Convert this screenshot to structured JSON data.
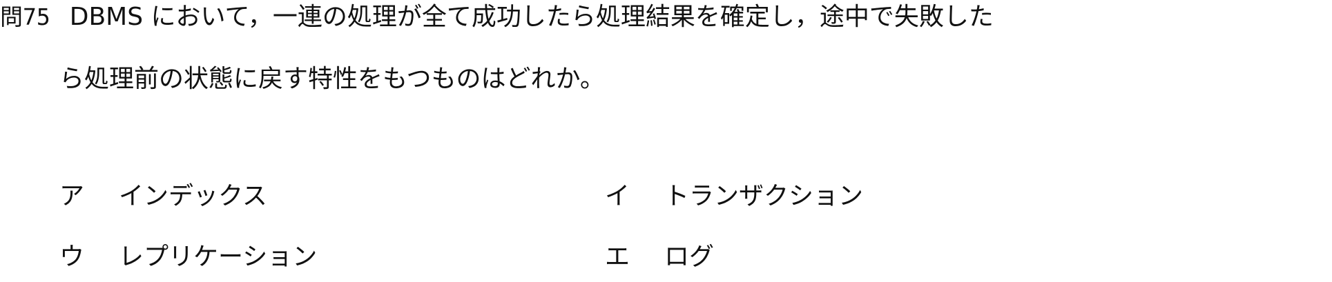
{
  "question": {
    "number": "問75",
    "line1": "DBMS において，一連の処理が全て成功したら処理結果を確定し，途中で失敗した",
    "line2": "ら処理前の状態に戻す特性をもつものはどれか。"
  },
  "choices": [
    {
      "key": "ア",
      "text": "インデックス"
    },
    {
      "key": "イ",
      "text": "トランザクション"
    },
    {
      "key": "ウ",
      "text": "レプリケーション"
    },
    {
      "key": "エ",
      "text": "ログ"
    }
  ]
}
